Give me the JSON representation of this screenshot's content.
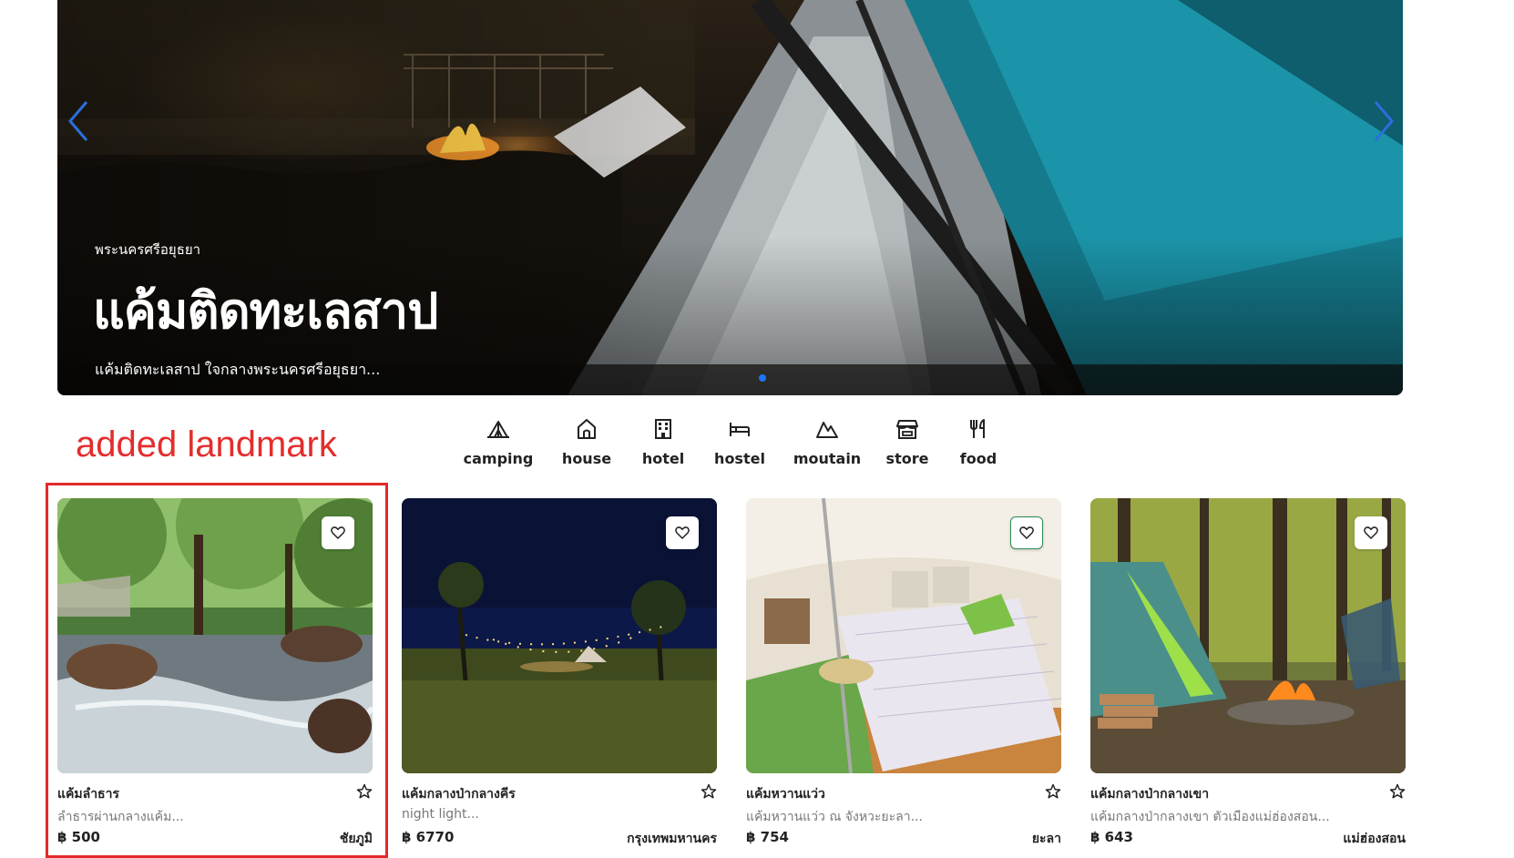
{
  "hero": {
    "subtitle": "พระนครศรีอยุธยา",
    "title": "แค้มติดทะเลสาป",
    "description": "แค้มติดทะเลสาป ใจกลางพระนครศรีอยุธยา...",
    "prev_icon": "chevron-left-icon",
    "next_icon": "chevron-right-icon",
    "active_dot_color": "#1d74f5"
  },
  "annotation": {
    "label": "added landmark",
    "color": "#e32d2d"
  },
  "categories": [
    {
      "label": "camping",
      "icon": "tent-icon"
    },
    {
      "label": "house",
      "icon": "house-icon"
    },
    {
      "label": "hotel",
      "icon": "building-icon"
    },
    {
      "label": "hostel",
      "icon": "bed-icon"
    },
    {
      "label": "moutain",
      "icon": "mountain-icon"
    },
    {
      "label": "store",
      "icon": "store-icon"
    },
    {
      "label": "food",
      "icon": "utensils-icon"
    }
  ],
  "cards": [
    {
      "title": "แค้มลำธาร",
      "description": "ลำธารผ่านกลางแค้ม...",
      "price": "฿ 500",
      "location": "ชัยภูมิ"
    },
    {
      "title": "แค้มกลางป่ากลางคีร",
      "description": "night light...",
      "price": "฿ 6770",
      "location": "กรุงเทพมหานคร"
    },
    {
      "title": "แค้มหวานแว่ว",
      "description": "แค้มหวานแว่ว ณ จังหวะยะลา...",
      "price": "฿ 754",
      "location": "ยะลา"
    },
    {
      "title": "แค้มกลางป่ากลางเขา",
      "description": "แค้มกลางป่ากลางเขา ตัวเมืองแม่ฮ่องสอน...",
      "price": "฿ 643",
      "location": "แม่ฮ่องสอน"
    }
  ]
}
